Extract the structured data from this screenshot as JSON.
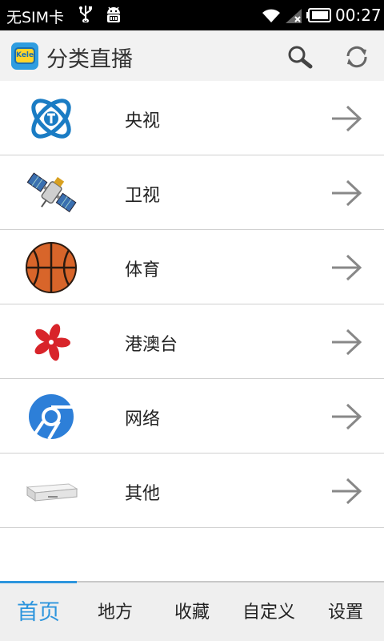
{
  "status_bar": {
    "carrier": "无SIM卡",
    "time": "00:27"
  },
  "action_bar": {
    "title": "分类直播",
    "logo_text": "Kele"
  },
  "categories": [
    {
      "label": "央视",
      "icon": "cctv-logo-icon"
    },
    {
      "label": "卫视",
      "icon": "satellite-icon"
    },
    {
      "label": "体育",
      "icon": "basketball-icon"
    },
    {
      "label": "港澳台",
      "icon": "bauhinia-flower-icon"
    },
    {
      "label": "网络",
      "icon": "chrome-globe-icon"
    },
    {
      "label": "其他",
      "icon": "set-top-box-icon"
    }
  ],
  "bottom_nav": {
    "items": [
      {
        "label": "首页",
        "active": true
      },
      {
        "label": "地方",
        "active": false
      },
      {
        "label": "收藏",
        "active": false
      },
      {
        "label": "自定义",
        "active": false
      },
      {
        "label": "设置",
        "active": false
      }
    ]
  },
  "colors": {
    "accent": "#2d95dd",
    "statusbar_bg": "#000000",
    "actionbar_bg": "#f2f2f2",
    "bottomnav_bg": "#efefef"
  }
}
